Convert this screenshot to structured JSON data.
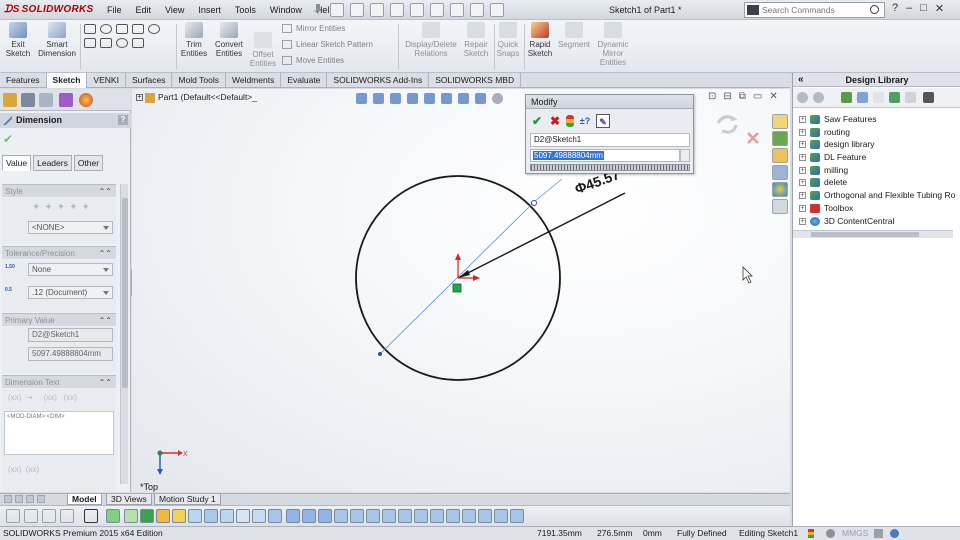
{
  "app": {
    "logo": "SOLIDWORKS",
    "document_title": "Sketch1 of Part1 *",
    "menus": [
      "File",
      "Edit",
      "View",
      "Insert",
      "Tools",
      "Window",
      "Help"
    ],
    "search_placeholder": "Search Commands",
    "window_controls": [
      "?",
      "–",
      "□",
      "✕"
    ]
  },
  "ribbon": {
    "exit_sketch": [
      "Exit",
      "Sketch"
    ],
    "smart_dimension": [
      "Smart",
      "Dimension"
    ],
    "trim_entities": [
      "Trim",
      "Entities"
    ],
    "convert_entities": [
      "Convert",
      "Entities"
    ],
    "offset_entities": [
      "Offset",
      "Entities"
    ],
    "mirror_entities": "Mirror Entities",
    "linear_sketch_pattern": "Linear Sketch Pattern",
    "move_entities": "Move Entities",
    "display_delete_relations": [
      "Display/Delete",
      "Relations"
    ],
    "repair_sketch": [
      "Repair",
      "Sketch"
    ],
    "quick_snaps": [
      "Quick",
      "Snaps"
    ],
    "rapid_sketch": [
      "Rapid",
      "Sketch"
    ],
    "segment": "Segment",
    "dynamic_mirror": [
      "Dynamic",
      "Mirror",
      "Entities"
    ]
  },
  "command_tabs": [
    {
      "label": "Features",
      "active": false
    },
    {
      "label": "Sketch",
      "active": true
    },
    {
      "label": "VENKI",
      "active": false
    },
    {
      "label": "Surfaces",
      "active": false
    },
    {
      "label": "Mold Tools",
      "active": false
    },
    {
      "label": "Weldments",
      "active": false
    },
    {
      "label": "Evaluate",
      "active": false
    },
    {
      "label": "SOLIDWORKS Add-Ins",
      "active": false
    },
    {
      "label": "SOLIDWORKS MBD",
      "active": false
    }
  ],
  "property_manager": {
    "title": "Dimension",
    "help": "?",
    "tabs": [
      "Value",
      "Leaders",
      "Other"
    ],
    "style": {
      "header": "Style",
      "value": "<NONE>"
    },
    "tolerance": {
      "header": "Tolerance/Precision",
      "tolerance_value": "None",
      "precision_value": ".12 (Document)"
    },
    "primary_value": {
      "header": "Primary Value",
      "name": "D2@Sketch1",
      "value": "5097.49888804mm"
    },
    "dimension_text": {
      "header": "Dimension Text",
      "text": "<MOD-DIAM> <DIM>"
    }
  },
  "graphics": {
    "tree_path": "Part1  (Default<<Default>_",
    "dimension_label": "Φ45.57",
    "view_label": "*Top"
  },
  "modify_dialog": {
    "title": "Modify",
    "name": "D2@Sketch1",
    "value": "5097.49888804mm"
  },
  "design_library": {
    "title": "Design Library",
    "items": [
      "Saw Features",
      "routing",
      "design library",
      "DL Feature",
      "milling",
      "delete",
      "Orthogonal and Flexible Tubing Ro",
      "Toolbox",
      "3D ContentCentral"
    ]
  },
  "model_tabs": [
    {
      "label": "Model",
      "active": true
    },
    {
      "label": "3D Views",
      "active": false
    },
    {
      "label": "Motion Study 1",
      "active": false
    }
  ],
  "status": {
    "edition": "SOLIDWORKS Premium 2015 x64 Edition",
    "x": "7191.35mm",
    "y": "276.5mm",
    "z": "0mm",
    "state": "Fully Defined",
    "editing": "Editing Sketch1",
    "units": "MMGS"
  },
  "colors": {
    "accent_red": "#b00000",
    "selection_blue": "#2e73d6",
    "sketch_black": "#1a1a1a",
    "construction_blue": "#5b8fd6"
  }
}
